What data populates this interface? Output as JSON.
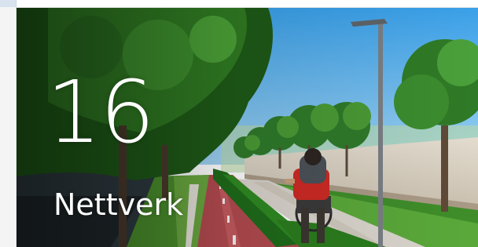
{
  "tile": {
    "number": "16",
    "label": "Nettverk",
    "image": "bike-path-photo"
  }
}
